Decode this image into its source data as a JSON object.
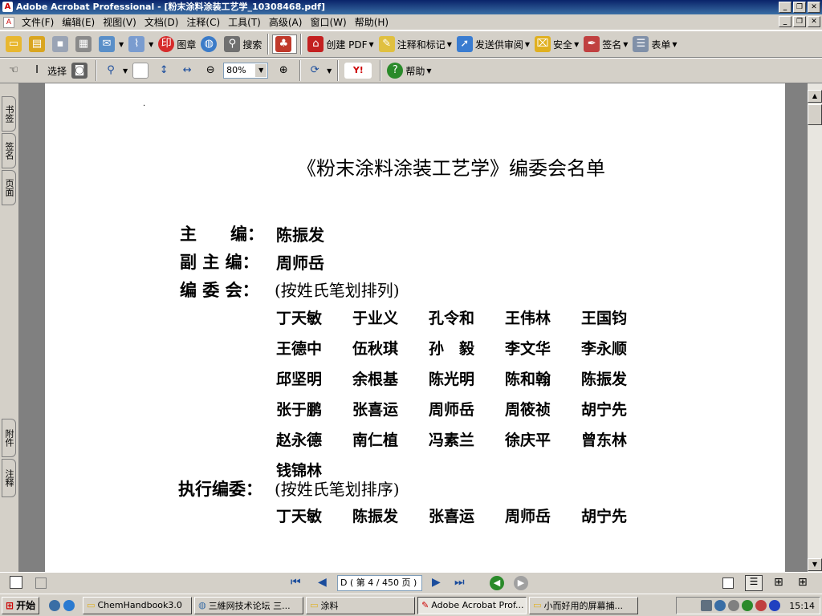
{
  "window": {
    "title": "Adobe Acrobat Professional - [粉末涂料涂装工艺学_10308468.pdf]"
  },
  "menu": [
    "文件(F)",
    "编辑(E)",
    "视图(V)",
    "文档(D)",
    "注释(C)",
    "工具(T)",
    "高级(A)",
    "窗口(W)",
    "帮助(H)"
  ],
  "toolbar1": {
    "stamp": "图章",
    "search": "搜索",
    "create_pdf": "创建 PDF",
    "comment": "注释和标记",
    "review": "发送供审阅",
    "security": "安全",
    "sign": "签名",
    "forms": "表单"
  },
  "toolbar2": {
    "select": "选择",
    "zoom": "80%",
    "help": "帮助"
  },
  "side_tabs": {
    "bookmarks": "书签",
    "signatures": "签名",
    "pages": "页面",
    "attachments": "附件",
    "comments": "注释"
  },
  "doc": {
    "mark": ".",
    "title": "《粉末涂料涂装工艺学》编委会名单",
    "chief_label": "主　　编：",
    "chief": "陈振发",
    "deputy_label": "副 主 编：",
    "deputy": "周师岳",
    "committee_label": "编 委 会：",
    "committee_note": "(按姓氏笔划排列)",
    "committee": [
      "丁天敏",
      "于业义",
      "孔令和",
      "王伟林",
      "王国钧",
      "王德中",
      "伍秋琪",
      "孙　毅",
      "李文华",
      "李永顺",
      "邱坚明",
      "余根基",
      "陈光明",
      "陈和翰",
      "陈振发",
      "张于鹏",
      "张喜运",
      "周师岳",
      "周筱祯",
      "胡宁先",
      "赵永德",
      "南仁植",
      "冯素兰",
      "徐庆平",
      "曾东林",
      "钱锦林"
    ],
    "exec_label": "执行编委：",
    "exec_note": "(按姓氏笔划排序)",
    "exec": [
      "丁天敏",
      "陈振发",
      "张喜运",
      "周师岳",
      "胡宁先"
    ]
  },
  "status": {
    "page_nav": "D ( 第 4 / 450 页 )"
  },
  "taskbar": {
    "start": "开始",
    "tasks": [
      "ChemHandbook3.0",
      "三維网技术论坛 三...",
      "涂料",
      "Adobe Acrobat Prof...",
      "小而好用的屏幕捕..."
    ],
    "clock": "15:14"
  }
}
